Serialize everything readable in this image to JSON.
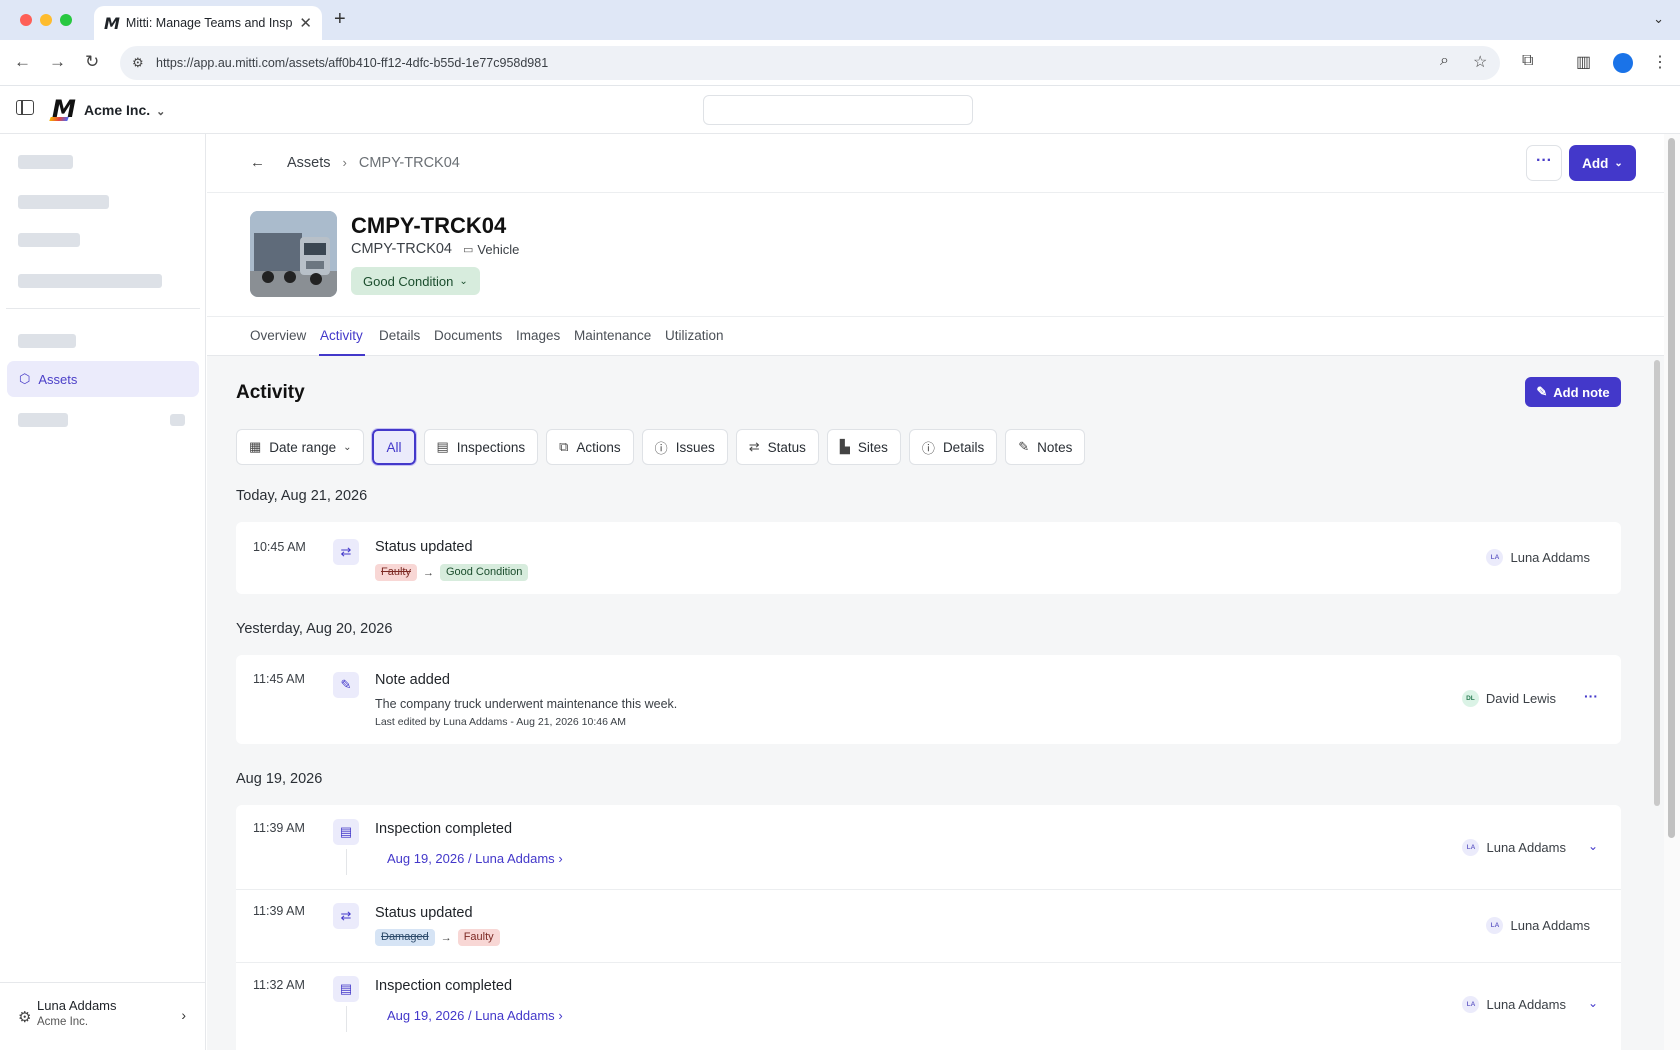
{
  "browser": {
    "tab_title": "Mitti: Manage Teams and Inspect...",
    "tab_logo": "M",
    "url": "https://app.au.mitti.com/assets/aff0b410-ff12-4dfc-b55d-1e77c958d981",
    "icons": [
      "back-icon",
      "forward-icon",
      "reload-icon",
      "site-info-icon",
      "zoom-icon",
      "star-icon",
      "extensions-icon",
      "sidepanel-icon",
      "profile-icon",
      "menu-icon"
    ]
  },
  "app": {
    "logo": "M",
    "org_name": "Acme Inc."
  },
  "sidebar": {
    "active_item": "Assets",
    "user_name": "Luna Addams",
    "user_org": "Acme Inc."
  },
  "breadcrumb": {
    "parent": "Assets",
    "current": "CMPY-TRCK04"
  },
  "actions": {
    "more": "···",
    "add": "Add"
  },
  "asset": {
    "title": "CMPY-TRCK04",
    "code": "CMPY-TRCK04",
    "type": "Vehicle",
    "condition": "Good Condition"
  },
  "tabs": [
    "Overview",
    "Activity",
    "Details",
    "Documents",
    "Images",
    "Maintenance",
    "Utilization"
  ],
  "activity": {
    "title": "Activity",
    "add_note": "Add note",
    "filters": {
      "date_range": "Date range",
      "all": "All",
      "inspections": "Inspections",
      "actions": "Actions",
      "issues": "Issues",
      "status": "Status",
      "sites": "Sites",
      "details": "Details",
      "notes": "Notes"
    },
    "days": [
      {
        "label": "Today, Aug 21, 2026",
        "events": [
          {
            "time": "10:45 AM",
            "title": "Status updated",
            "from": "Faulty",
            "to": "Good Condition",
            "user_initials": "LA",
            "user": "Luna Addams"
          }
        ]
      },
      {
        "label": "Yesterday, Aug 20, 2026",
        "events": [
          {
            "time": "11:45 AM",
            "title": "Note added",
            "body": "The company truck underwent maintenance this week.",
            "meta": "Last edited by Luna Addams - Aug 21, 2026 10:46 AM",
            "user_initials": "DL",
            "user": "David Lewis",
            "more": "···"
          }
        ]
      },
      {
        "label": "Aug 19, 2026",
        "events": [
          {
            "time": "11:39 AM",
            "title": "Inspection completed",
            "link": "Aug 19, 2026 / Luna Addams",
            "user_initials": "LA",
            "user": "Luna Addams"
          },
          {
            "time": "11:39 AM",
            "title": "Status updated",
            "from": "Damaged",
            "to": "Faulty",
            "user_initials": "LA",
            "user": "Luna Addams"
          },
          {
            "time": "11:32 AM",
            "title": "Inspection completed",
            "link": "Aug 19, 2026 / Luna Addams",
            "user_initials": "LA",
            "user": "Luna Addams"
          }
        ]
      }
    ]
  },
  "colors": {
    "accent": "#4338ca",
    "good": "#d7ecdd",
    "faulty": "#f8d7d5",
    "damaged": "#d6e4f5"
  }
}
